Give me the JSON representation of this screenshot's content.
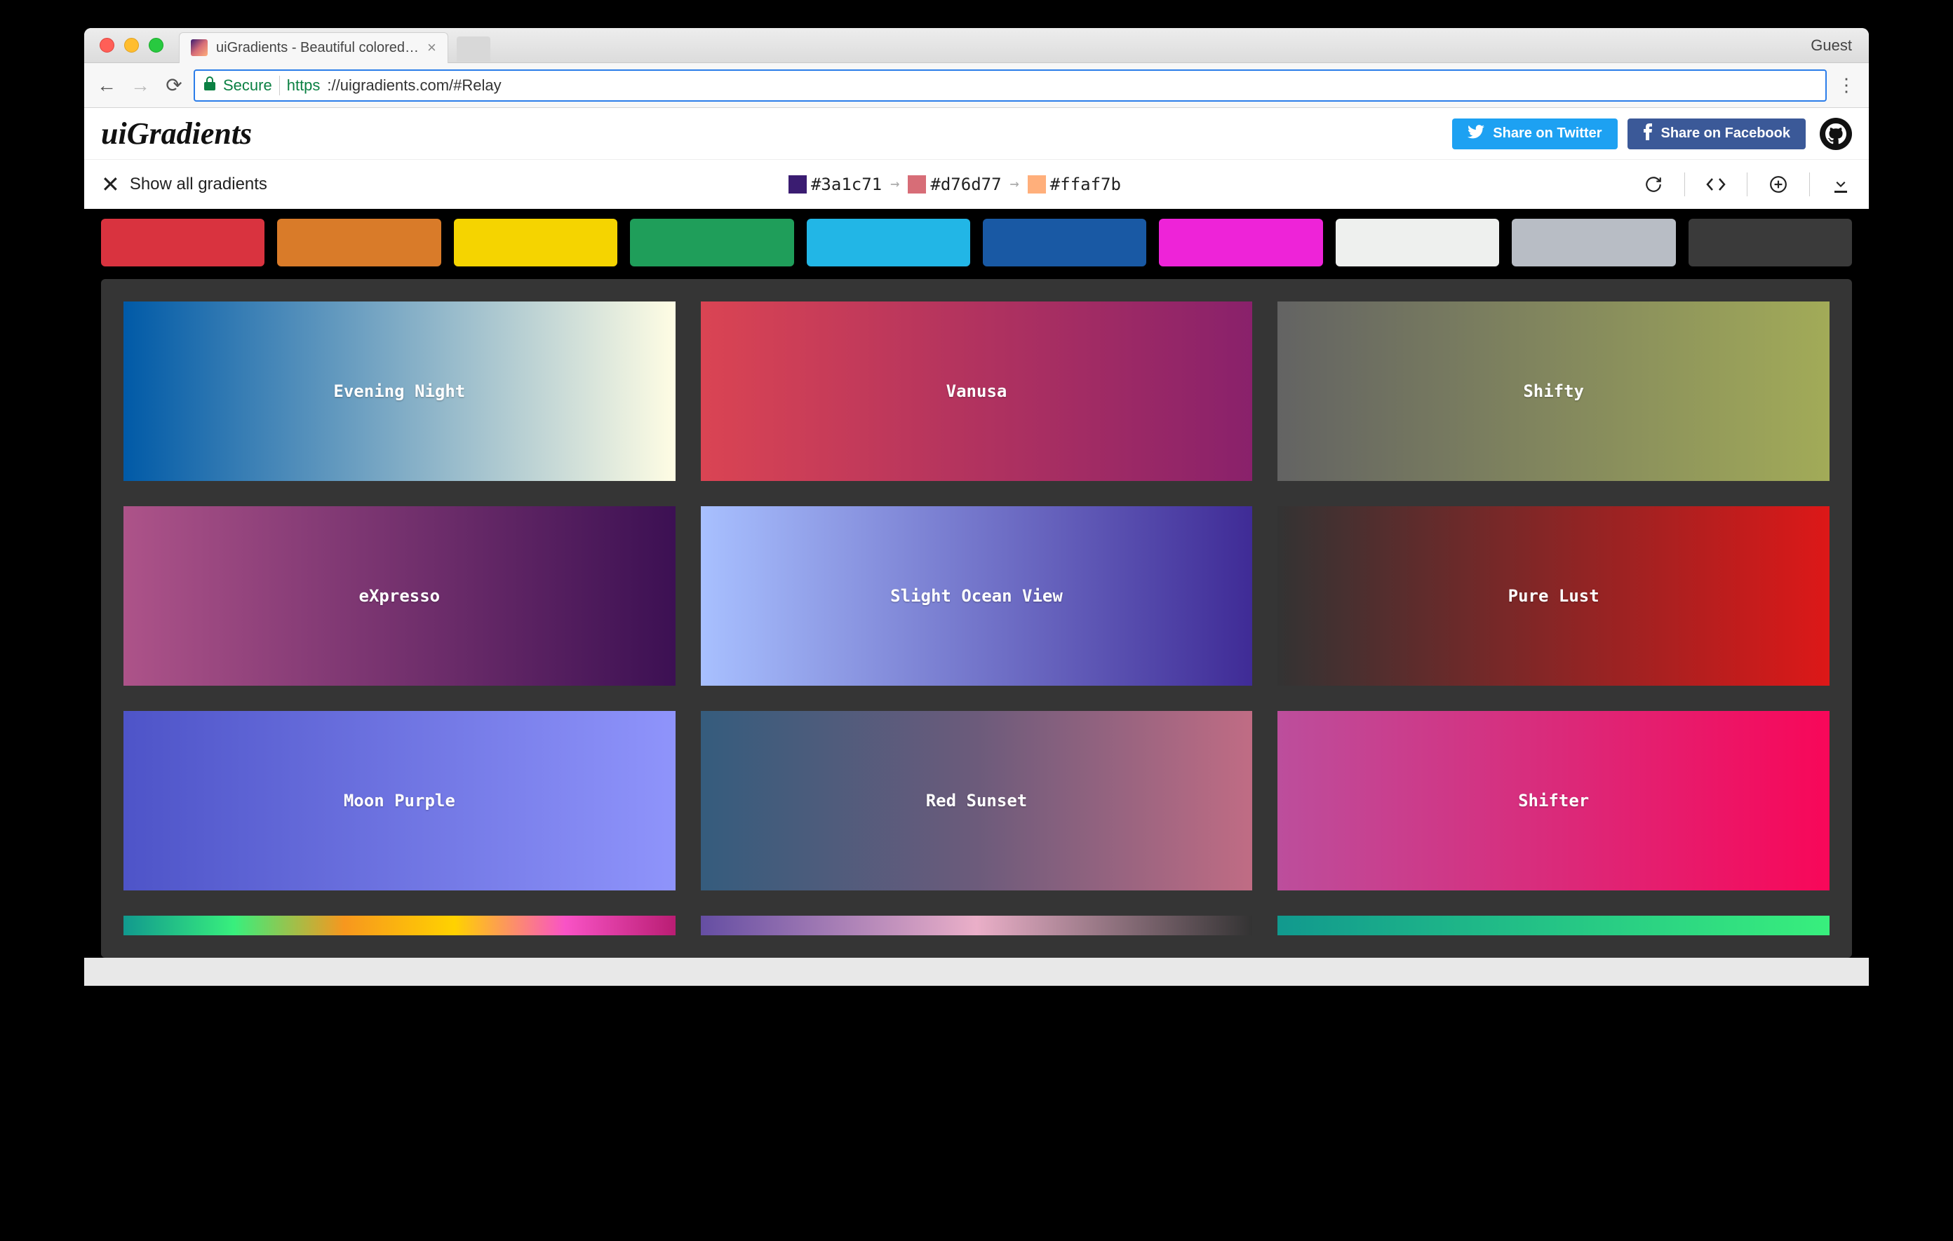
{
  "browser": {
    "tab_title": "uiGradients - Beautiful colored…",
    "guest_label": "Guest",
    "secure_label": "Secure",
    "url_protocol": "https",
    "url_rest": "://uigradients.com/#Relay"
  },
  "header": {
    "logo": "uiGradients",
    "twitter_label": "Share on Twitter",
    "facebook_label": "Share on Facebook"
  },
  "subheader": {
    "show_all_label": "Show all gradients",
    "colors": [
      {
        "hex": "#3a1c71",
        "swatch": "#3a1c71"
      },
      {
        "hex": "#d76d77",
        "swatch": "#d76d77"
      },
      {
        "hex": "#ffaf7b",
        "swatch": "#ffaf7b"
      }
    ]
  },
  "filters": [
    {
      "color": "#d9333f"
    },
    {
      "color": "#d97b29"
    },
    {
      "color": "#f5d400"
    },
    {
      "color": "#1f9e5a"
    },
    {
      "color": "#22b6e6"
    },
    {
      "color": "#1959a4"
    },
    {
      "color": "#ee23d8"
    },
    {
      "color": "#eef0ee"
    },
    {
      "color": "#b8bdc5"
    },
    {
      "color": "#3a3a3a"
    }
  ],
  "gradients": [
    {
      "name": "Evening Night",
      "stops": [
        "#005aa7",
        "#fffde4"
      ]
    },
    {
      "name": "Vanusa",
      "stops": [
        "#da4453",
        "#89216b"
      ]
    },
    {
      "name": "Shifty",
      "stops": [
        "#636363",
        "#a2ab58"
      ]
    },
    {
      "name": "eXpresso",
      "stops": [
        "#ad5389",
        "#3c1053"
      ]
    },
    {
      "name": "Slight Ocean View",
      "stops": [
        "#a8c0ff",
        "#3f2b96"
      ]
    },
    {
      "name": "Pure Lust",
      "stops": [
        "#333333",
        "#dd1818"
      ]
    },
    {
      "name": "Moon Purple",
      "stops": [
        "#4e54c8",
        "#8f94fb"
      ]
    },
    {
      "name": "Red Sunset",
      "stops": [
        "#355c7d",
        "#6c5b7b",
        "#c06c84"
      ]
    },
    {
      "name": "Shifter",
      "stops": [
        "#bc4e9c",
        "#f80759"
      ]
    }
  ],
  "peek_row": [
    {
      "stops": [
        "#11998e",
        "#38ef7d",
        "#f7971e",
        "#ffd200",
        "#f953c6",
        "#b91d73"
      ]
    },
    {
      "stops": [
        "#654ea3",
        "#eaafc8",
        "#333333"
      ]
    },
    {
      "stops": [
        "#11998e",
        "#38ef7d"
      ]
    }
  ]
}
